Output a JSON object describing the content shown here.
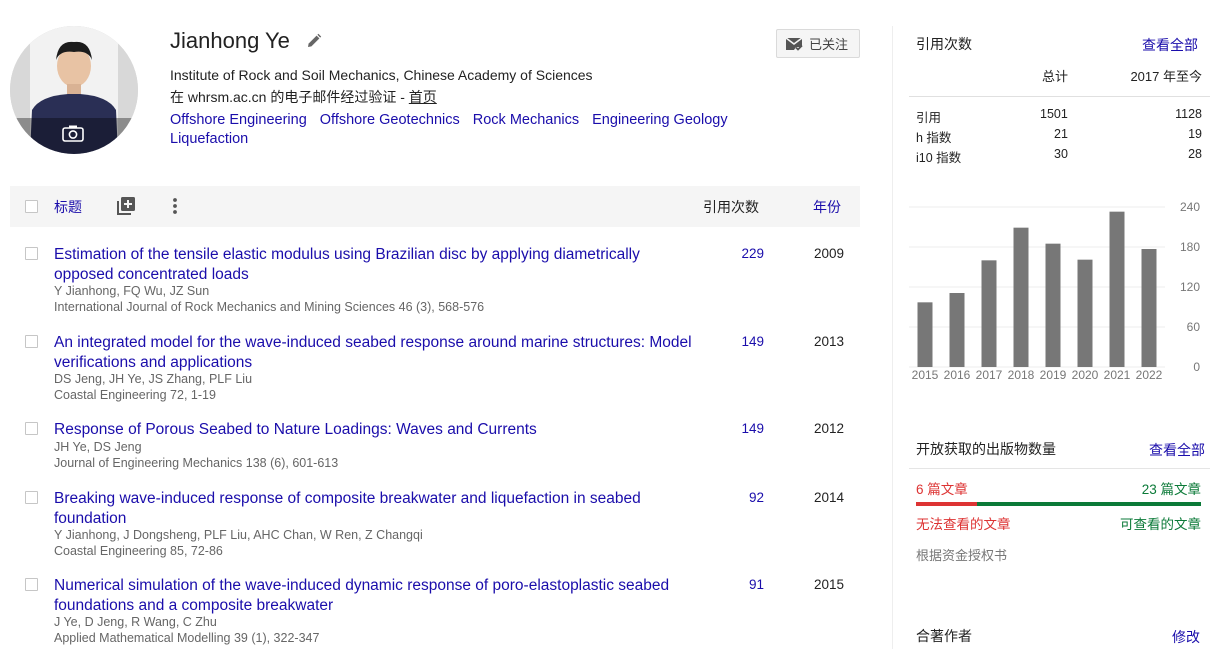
{
  "profile": {
    "name": "Jianhong Ye",
    "affiliation": "Institute of Rock and Soil Mechanics, Chinese Academy of Sciences",
    "email_prefix": "在 whrsm.ac.cn 的电子邮件经过验证 - ",
    "home_link": "首页",
    "interests": [
      "Offshore Engineering",
      "Offshore Geotechnics",
      "Rock Mechanics",
      "Engineering Geology",
      "Liquefaction"
    ],
    "follow_label": "已关注"
  },
  "table": {
    "header": {
      "title": "标题",
      "cites": "引用次数",
      "year": "年份"
    },
    "rows": [
      {
        "title": "Estimation of the tensile elastic modulus using Brazilian disc by applying diametrically opposed concentrated loads",
        "authors": "Y Jianhong, FQ Wu, JZ Sun",
        "venue": "International Journal of Rock Mechanics and Mining Sciences 46 (3), 568-576",
        "cites": "229",
        "year": "2009"
      },
      {
        "title": "An integrated model for the wave-induced seabed response around marine structures: Model verifications and applications",
        "authors": "DS Jeng, JH Ye, JS Zhang, PLF Liu",
        "venue": "Coastal Engineering 72, 1-19",
        "cites": "149",
        "year": "2013"
      },
      {
        "title": "Response of Porous Seabed to Nature Loadings: Waves and Currents",
        "authors": "JH Ye, DS Jeng",
        "venue": "Journal of Engineering Mechanics 138 (6), 601-613",
        "cites": "149",
        "year": "2012"
      },
      {
        "title": "Breaking wave-induced response of composite breakwater and liquefaction in seabed foundation",
        "authors": "Y Jianhong, J Dongsheng, PLF Liu, AHC Chan, W Ren, Z Changqi",
        "venue": "Coastal Engineering 85, 72-86",
        "cites": "92",
        "year": "2014"
      },
      {
        "title": "Numerical simulation of the wave-induced dynamic response of poro-elastoplastic seabed foundations and a composite breakwater",
        "authors": "J Ye, D Jeng, R Wang, C Zhu",
        "venue": "Applied Mathematical Modelling 39 (1), 322-347",
        "cites": "91",
        "year": "2015"
      }
    ]
  },
  "cited_by": {
    "heading": "引用次数",
    "view_all": "查看全部",
    "col_total": "总计",
    "col_since": "2017 年至今",
    "rows": [
      {
        "label": "引用",
        "total": "1501",
        "since": "1128"
      },
      {
        "label": "h 指数",
        "total": "21",
        "since": "19"
      },
      {
        "label": "i10 指数",
        "total": "30",
        "since": "28"
      }
    ]
  },
  "chart_data": {
    "type": "bar",
    "categories": [
      "2015",
      "2016",
      "2017",
      "2018",
      "2019",
      "2020",
      "2021",
      "2022"
    ],
    "values": [
      97,
      111,
      160,
      209,
      185,
      161,
      233,
      177
    ],
    "ylim": [
      0,
      240
    ],
    "yticks": [
      "240",
      "180",
      "120",
      "60",
      "0"
    ],
    "bar_color": "#777777"
  },
  "open_access": {
    "heading": "开放获取的出版物数量",
    "view_all": "查看全部",
    "unavailable_count": "6 篇文章",
    "available_count": "23 篇文章",
    "unavailable_label": "无法查看的文章",
    "available_label": "可查看的文章",
    "note": "根据资金授权书"
  },
  "coauthors": {
    "heading": "合著作者",
    "edit": "修改"
  }
}
